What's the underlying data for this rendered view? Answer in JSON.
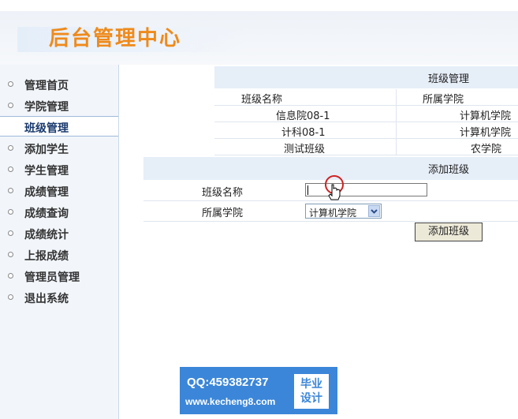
{
  "header": {
    "title": "后台管理中心"
  },
  "sidebar": {
    "items": [
      {
        "label": "管理首页"
      },
      {
        "label": "学院管理"
      },
      {
        "label": "班级管理"
      },
      {
        "label": "添加学生"
      },
      {
        "label": "学生管理"
      },
      {
        "label": "成绩管理"
      },
      {
        "label": "成绩查询"
      },
      {
        "label": "成绩统计"
      },
      {
        "label": "上报成绩"
      },
      {
        "label": "管理员管理"
      },
      {
        "label": "退出系统"
      }
    ]
  },
  "class_table": {
    "title": "班级管理",
    "columns": [
      "班级名称",
      "所属学院"
    ],
    "rows": [
      [
        "信息院08-1",
        "计算机学院"
      ],
      [
        "计科08-1",
        "计算机学院"
      ],
      [
        "测试班级",
        "农学院"
      ]
    ]
  },
  "add_form": {
    "title": "添加班级",
    "name_label": "班级名称",
    "name_value": "",
    "college_label": "所属学院",
    "college_selected": "计算机学院",
    "submit_label": "添加班级"
  },
  "watermark": {
    "qq": "QQ:459382737",
    "url": "www.kecheng8.com",
    "badge_line1": "毕业",
    "badge_line2": "设计"
  }
}
